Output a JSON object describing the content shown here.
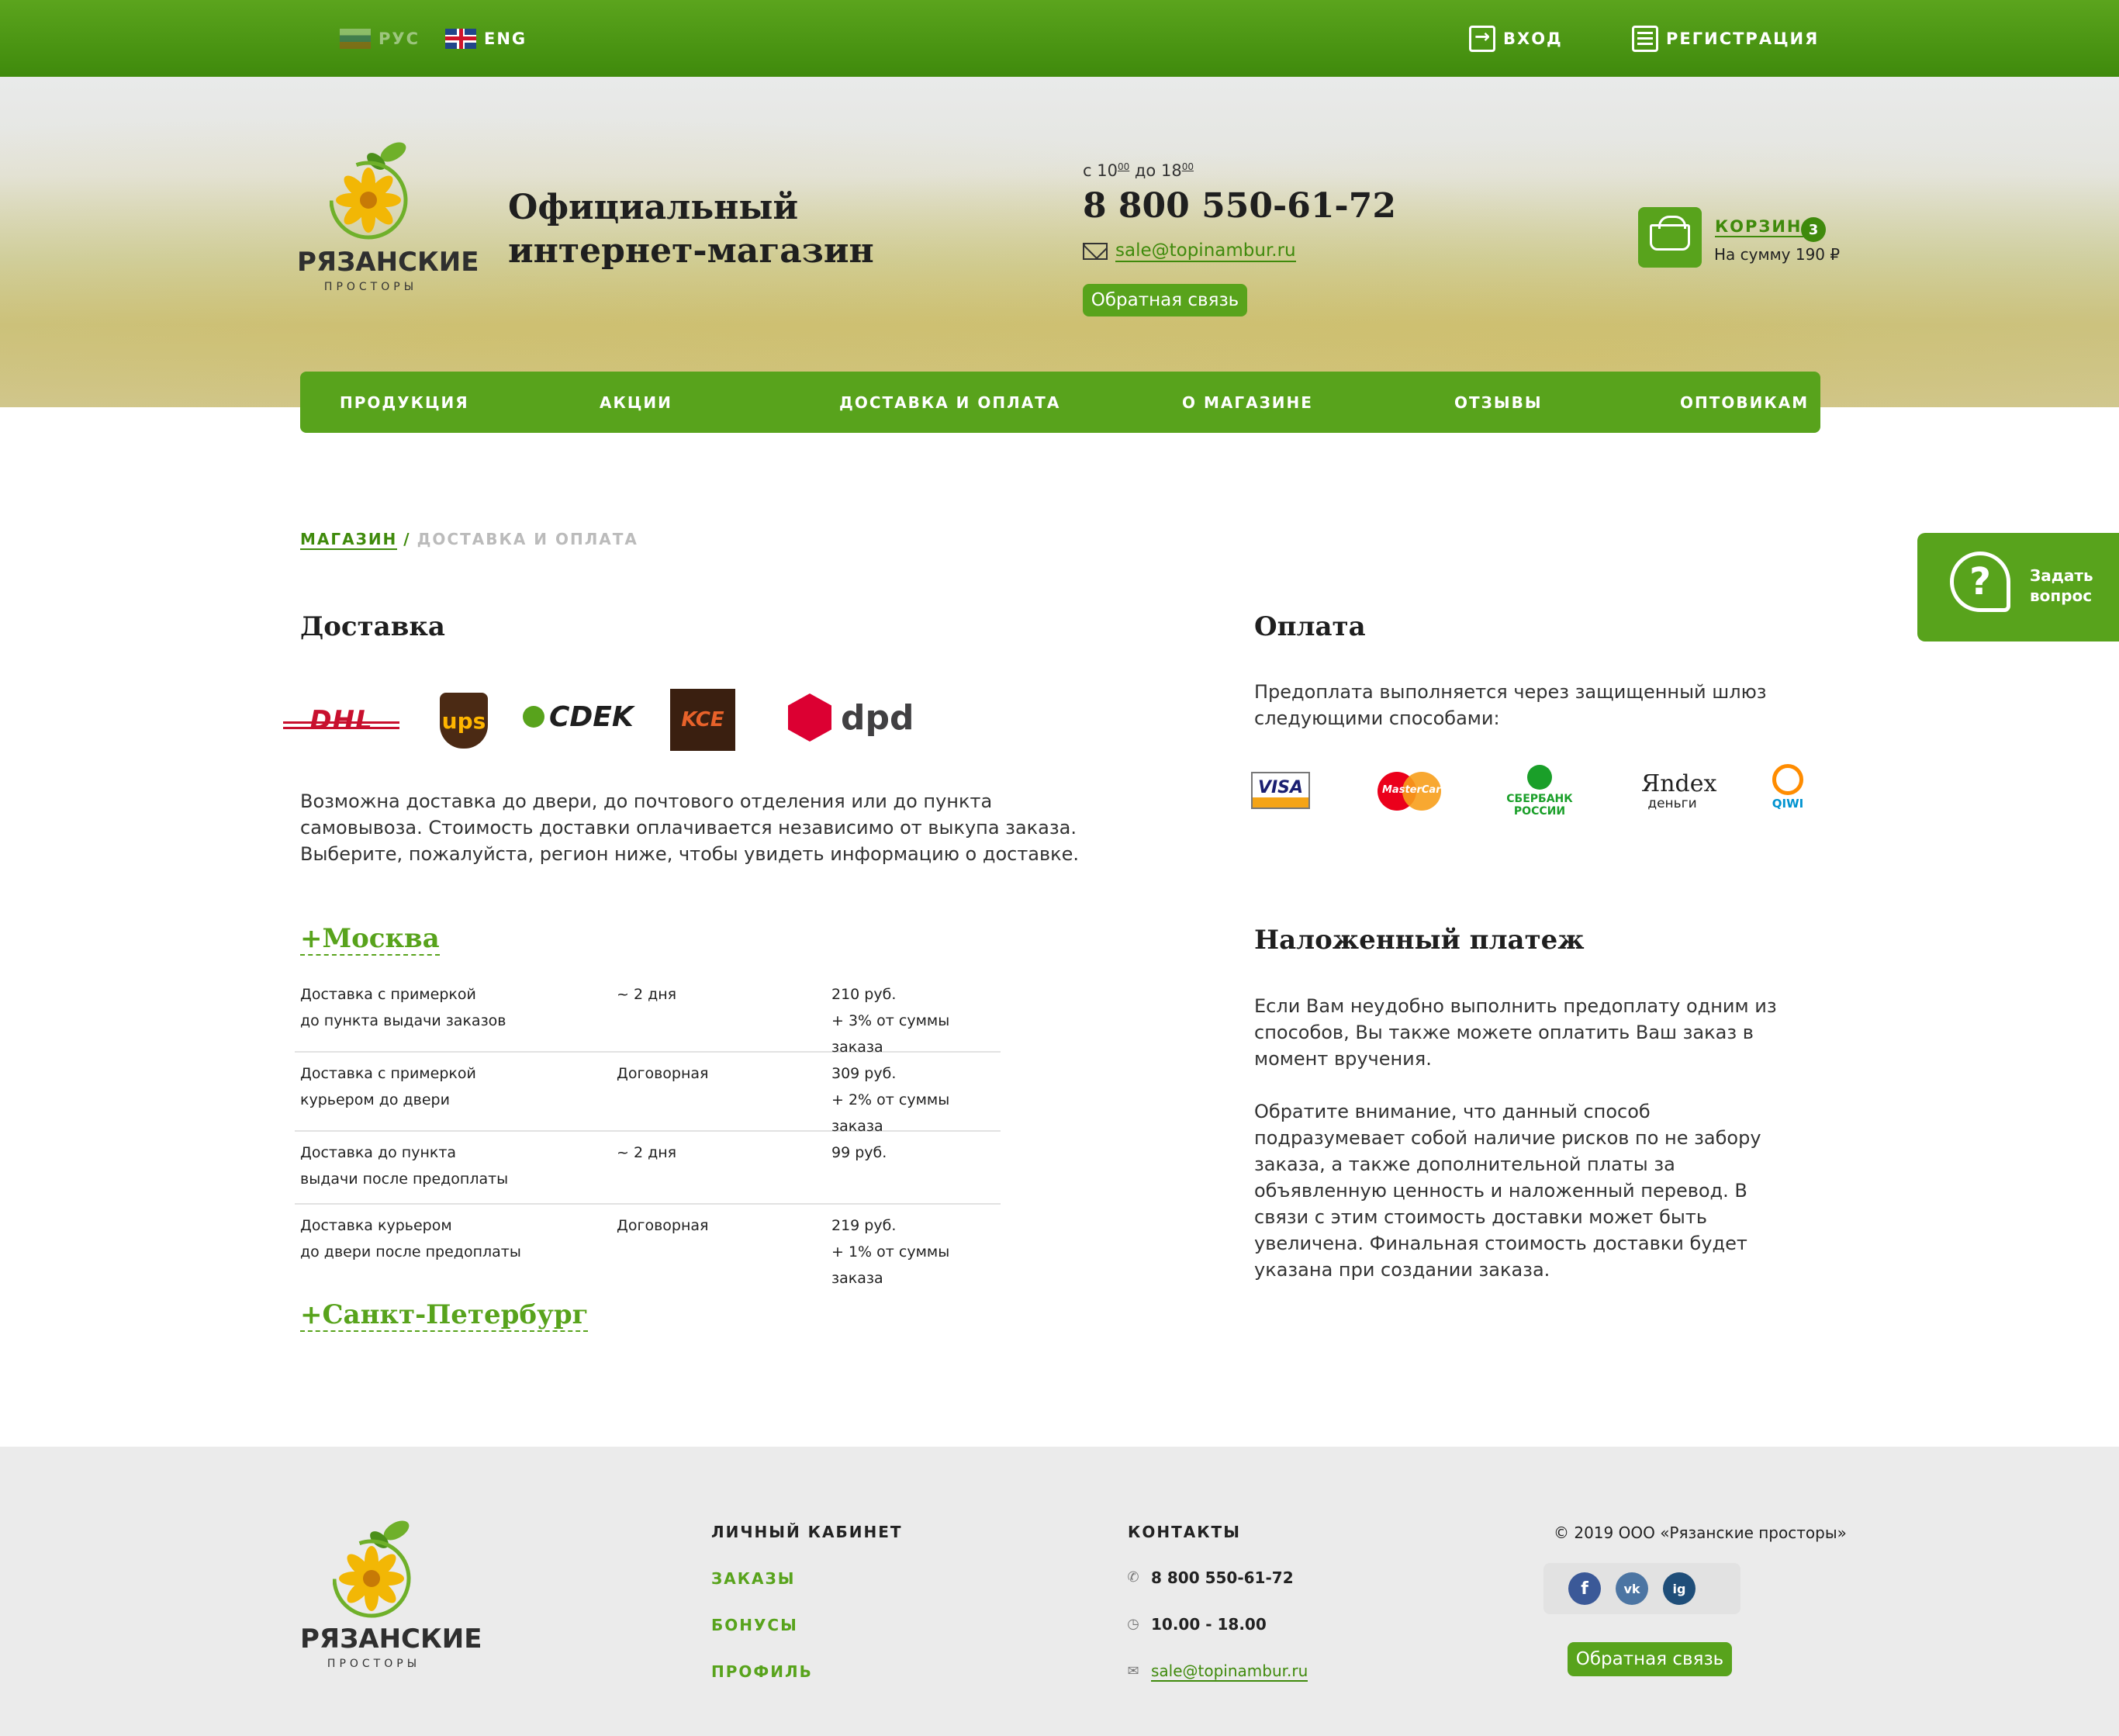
{
  "topbar": {
    "lang_ru": "РУС",
    "lang_en": "ENG",
    "login": "ВХОД",
    "register": "РЕГИСТРАЦИЯ"
  },
  "brand": {
    "name1": "РЯЗАНСКИЕ",
    "name2": "ПРОСТОРЫ"
  },
  "header": {
    "tagline_line1": "Официальный",
    "tagline_line2": "интернет-магазин",
    "hours_from": "с 10",
    "hours_from_min": "00",
    "hours_to": " до 18",
    "hours_to_min": "00",
    "phone": "8 800 550-61-72",
    "email": "sale@topinambur.ru",
    "feedback": "Обратная связь"
  },
  "cart": {
    "title": "КОРЗИНА",
    "count": "3",
    "sum": "На сумму 190 ₽"
  },
  "nav": [
    "ПРОДУКЦИЯ",
    "АКЦИИ",
    "ДОСТАВКА И ОПЛАТА",
    "О МАГАЗИНЕ",
    "ОТЗЫВЫ",
    "ОПТОВИКАМ"
  ],
  "breadcrumbs": {
    "link": "МАГАЗИН",
    "sep": "/",
    "current": "ДОСТАВКА И ОПЛАТА"
  },
  "ask": {
    "icon": "?",
    "line1": "Задать",
    "line2": "вопрос"
  },
  "delivery": {
    "title": "Доставка",
    "carriers": [
      "DHL",
      "ups",
      "CDEK",
      "KCE",
      "dpd"
    ],
    "text": [
      "Возможна доставка до двери, до почтового отделения или до пункта",
      "самовывоза. Стоимость доставки оплачивается независимо от выкупа заказа.",
      "Выберите, пожалуйста, регион ниже, чтобы увидеть информацию о доставке."
    ],
    "moscow": "+Москва",
    "rows": [
      {
        "name1": "Доставка с примеркой",
        "name2": "до пункта выдачи заказов",
        "term": "~ 2 дня",
        "price1": "210 руб.",
        "price2": "+ 3% от суммы заказа"
      },
      {
        "name1": "Доставка с примеркой",
        "name2": "курьером до двери",
        "term": "Договорная",
        "price1": "309 руб.",
        "price2": "+ 2% от суммы заказа"
      },
      {
        "name1": "Доставка до пункта",
        "name2": "выдачи после предоплаты",
        "term": "~ 2 дня",
        "price1": "99 руб.",
        "price2": ""
      },
      {
        "name1": "Доставка курьером",
        "name2": "до двери после предоплаты",
        "term": "Договорная",
        "price1": "219 руб.",
        "price2": "+ 1% от суммы заказа"
      }
    ],
    "spb": "+Санкт-Петербург"
  },
  "payment": {
    "title": "Оплата",
    "text": [
      "Предоплата выполняется через защищенный шлюз",
      "следующими способами:"
    ],
    "methods": {
      "visa": "VISA",
      "mastercard": "MasterCard",
      "sber1": "СБЕРБАНК",
      "sber2": "РОССИИ",
      "yandex1": "Яndex",
      "yandex2": "деньги",
      "qiwi": "QIWI"
    }
  },
  "cod": {
    "title": "Наложенный платеж",
    "text1": [
      "Если Вам неудобно выполнить предоплату одним из",
      "способов, Вы также можете оплатить Ваш заказ в",
      "момент вручения."
    ],
    "text2": [
      "Обратите внимание, что данный способ",
      "подразумевает собой наличие рисков по не забору",
      "заказа, а также дополнительной платы за",
      "объявленную ценность и наложенный перевод. В",
      "связи с этим стоимость доставки может быть",
      "увеличена. Финальная стоимость доставки будет",
      "указана при создании заказа."
    ]
  },
  "footer": {
    "account_title": "ЛИЧНЫЙ КАБИНЕТ",
    "account_links": [
      "ЗАКАЗЫ",
      "БОНУСЫ",
      "ПРОФИЛЬ"
    ],
    "contacts_title": "КОНТАКТЫ",
    "phone": "8 800 550-61-72",
    "hours": "10.00 - 18.00",
    "email": "sale@topinambur.ru",
    "copyright": "© 2019 ООО «Рязанские просторы»",
    "social": [
      "f",
      "vk",
      "ig"
    ],
    "feedback": "Обратная связь"
  },
  "colors": {
    "brand_green": "#58a31c",
    "dark_green": "#3f8a0c",
    "footer_bg": "#ebebeb"
  }
}
